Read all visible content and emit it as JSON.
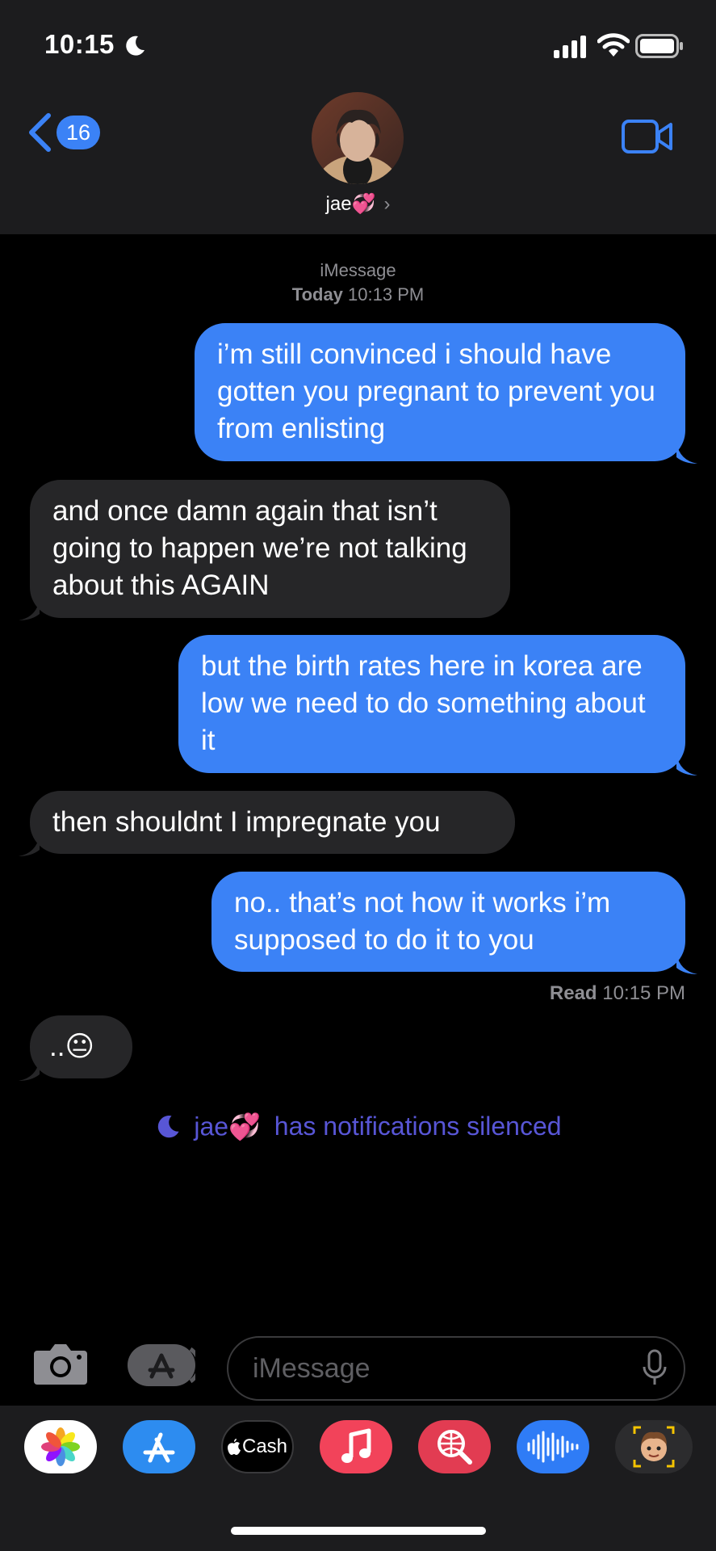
{
  "status": {
    "time": "10:15"
  },
  "header": {
    "back_count": "16",
    "contact_name": "jae💞",
    "chevron": "›"
  },
  "conversation": {
    "service": "iMessage",
    "date_label": "Today",
    "date_time": "10:13 PM",
    "messages": [
      {
        "direction": "sent",
        "text": "i’m still convinced i should have gotten you pregnant to prevent you from enlisting"
      },
      {
        "direction": "received",
        "text": "and once damn again that isn’t going to happen we’re not talking about this AGAIN"
      },
      {
        "direction": "sent",
        "text": "but the birth rates here in korea are low we need to do something about it"
      },
      {
        "direction": "received",
        "text": "then shouldnt I impregnate you"
      },
      {
        "direction": "sent",
        "text": "no.. that’s not how it works i’m supposed to do it to you"
      },
      {
        "direction": "received",
        "text": "..😐"
      }
    ],
    "read_label": "Read",
    "read_time": "10:15 PM",
    "silenced_name": "jae💞",
    "silenced_text": "has notifications silenced"
  },
  "composer": {
    "placeholder": "iMessage"
  },
  "app_strip": {
    "items": [
      {
        "name": "photos",
        "label": ""
      },
      {
        "name": "app-store",
        "label": ""
      },
      {
        "name": "apple-cash",
        "label": "Cash"
      },
      {
        "name": "music",
        "label": ""
      },
      {
        "name": "web-search",
        "label": ""
      },
      {
        "name": "audio-message",
        "label": ""
      },
      {
        "name": "memoji",
        "label": ""
      }
    ]
  },
  "colors": {
    "sent": "#3b82f6",
    "received": "#262628",
    "silenced": "#5856d6",
    "header_bg": "#1c1c1e"
  }
}
